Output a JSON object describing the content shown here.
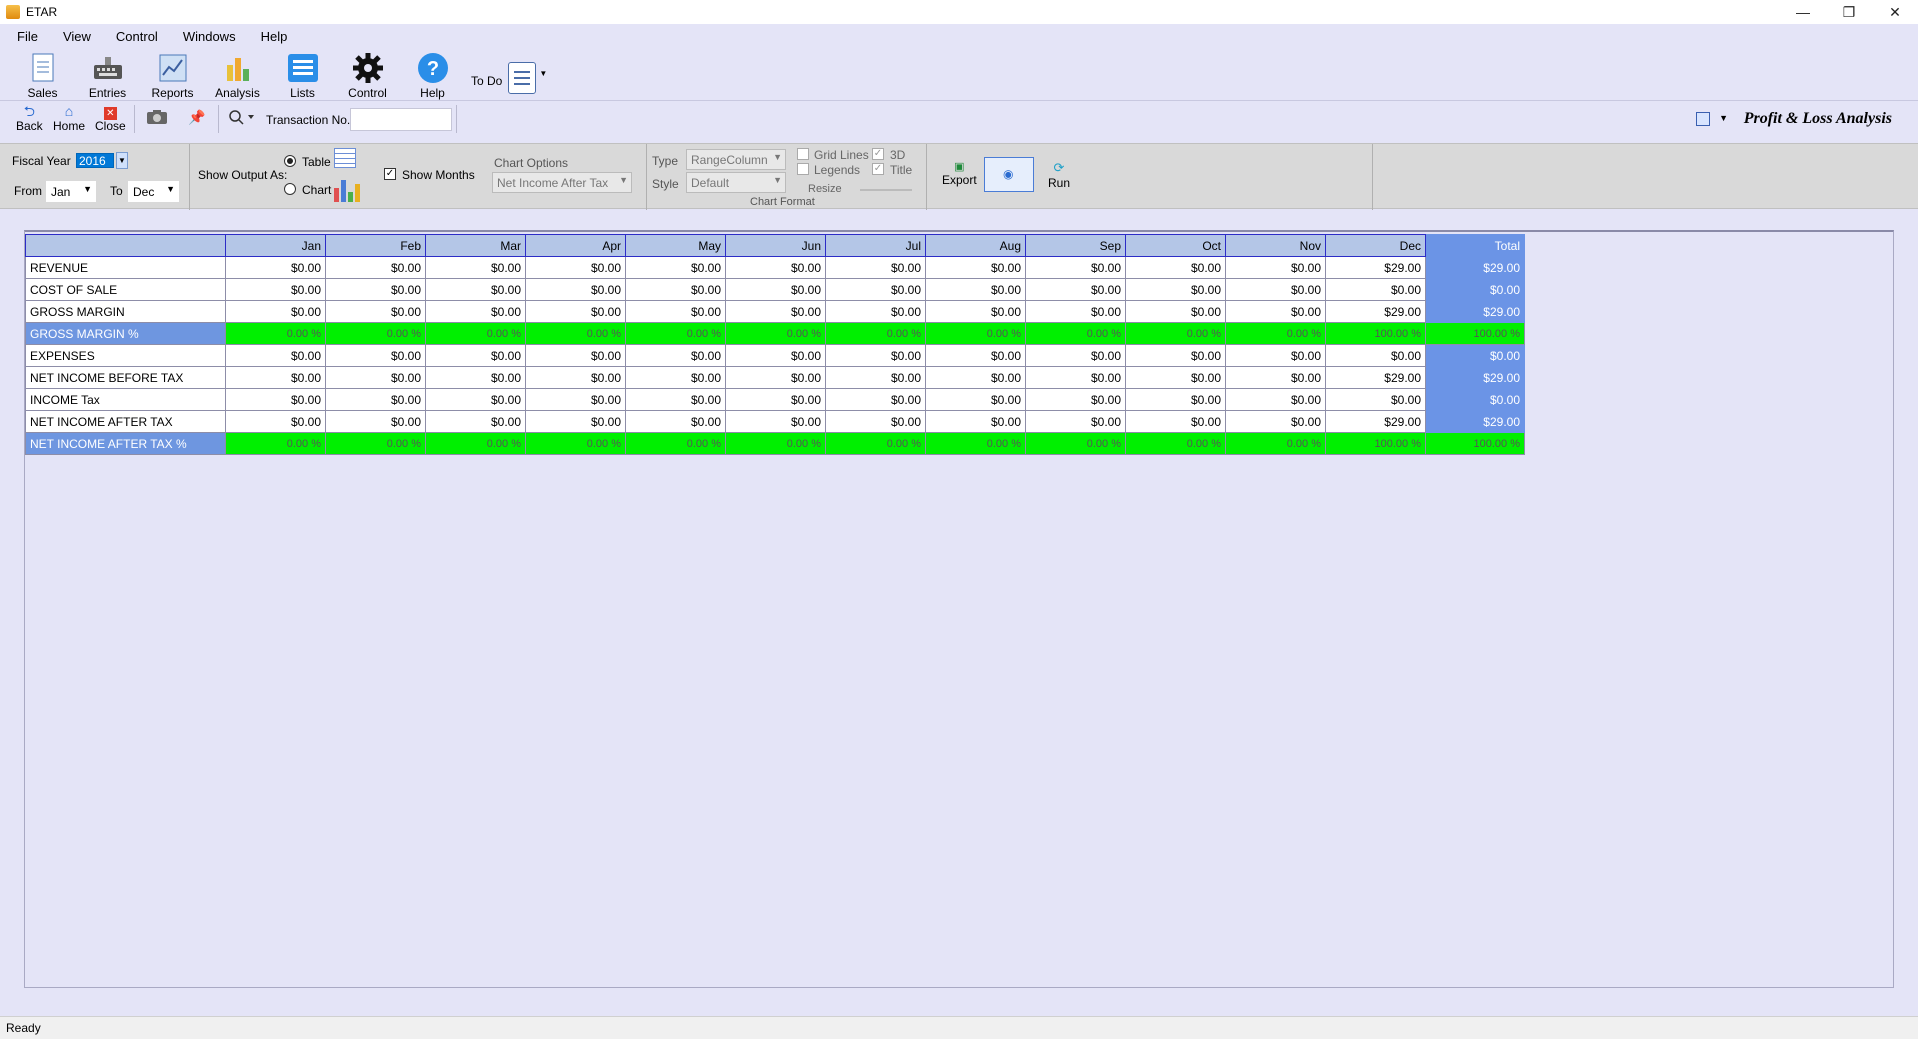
{
  "window": {
    "title": "ETAR",
    "minimize": "—",
    "restore": "❐",
    "close": "✕"
  },
  "menu": [
    "File",
    "View",
    "Control",
    "Windows",
    "Help"
  ],
  "big_toolbar": {
    "items": [
      {
        "label": "Sales",
        "icon": "sales-icon"
      },
      {
        "label": "Entries",
        "icon": "entries-icon"
      },
      {
        "label": "Reports",
        "icon": "reports-icon"
      },
      {
        "label": "Analysis",
        "icon": "analysis-icon"
      },
      {
        "label": "Lists",
        "icon": "lists-icon"
      },
      {
        "label": "Control",
        "icon": "gear-icon"
      },
      {
        "label": "Help",
        "icon": "help-icon"
      }
    ],
    "todo_label": "To Do"
  },
  "small_toolbar": {
    "back": "Back",
    "home": "Home",
    "close": "Close",
    "transaction_label": "Transaction No.",
    "transaction_value": "",
    "page_title": "Profit & Loss Analysis"
  },
  "options": {
    "fiscal_year_label": "Fiscal Year",
    "fiscal_year": "2016",
    "from_label": "From",
    "from_value": "Jan",
    "to_label": "To",
    "to_value": "Dec",
    "show_output_label": "Show Output As:",
    "table_label": "Table",
    "chart_label": "Chart",
    "output_selected": "Table",
    "show_months_label": "Show Months",
    "show_months_checked": true,
    "chart_options_label": "Chart Options",
    "chart_options_value": "Net Income After Tax",
    "type_label": "Type",
    "type_value": "RangeColumn",
    "style_label": "Style",
    "style_value": "Default",
    "chart_format_label": "Chart Format",
    "grid_lines_label": "Grid Lines",
    "legends_label": "Legends",
    "three_d_label": "3D",
    "title_label": "Title",
    "resize_label": "Resize",
    "export_label": "Export",
    "run_label": "Run"
  },
  "table": {
    "columns": [
      "Jan",
      "Feb",
      "Mar",
      "Apr",
      "May",
      "Jun",
      "Jul",
      "Aug",
      "Sep",
      "Oct",
      "Nov",
      "Dec",
      "Total"
    ],
    "rows": [
      {
        "label": "REVENUE",
        "pct": false,
        "values": [
          "$0.00",
          "$0.00",
          "$0.00",
          "$0.00",
          "$0.00",
          "$0.00",
          "$0.00",
          "$0.00",
          "$0.00",
          "$0.00",
          "$0.00",
          "$29.00",
          "$29.00"
        ]
      },
      {
        "label": "COST OF SALE",
        "pct": false,
        "values": [
          "$0.00",
          "$0.00",
          "$0.00",
          "$0.00",
          "$0.00",
          "$0.00",
          "$0.00",
          "$0.00",
          "$0.00",
          "$0.00",
          "$0.00",
          "$0.00",
          "$0.00"
        ]
      },
      {
        "label": "GROSS MARGIN",
        "pct": false,
        "values": [
          "$0.00",
          "$0.00",
          "$0.00",
          "$0.00",
          "$0.00",
          "$0.00",
          "$0.00",
          "$0.00",
          "$0.00",
          "$0.00",
          "$0.00",
          "$29.00",
          "$29.00"
        ]
      },
      {
        "label": "GROSS MARGIN %",
        "pct": true,
        "values": [
          "0.00 %",
          "0.00 %",
          "0.00 %",
          "0.00 %",
          "0.00 %",
          "0.00 %",
          "0.00 %",
          "0.00 %",
          "0.00 %",
          "0.00 %",
          "0.00 %",
          "100.00 %",
          "100.00 %"
        ]
      },
      {
        "label": "EXPENSES",
        "pct": false,
        "values": [
          "$0.00",
          "$0.00",
          "$0.00",
          "$0.00",
          "$0.00",
          "$0.00",
          "$0.00",
          "$0.00",
          "$0.00",
          "$0.00",
          "$0.00",
          "$0.00",
          "$0.00"
        ]
      },
      {
        "label": "NET INCOME BEFORE TAX",
        "pct": false,
        "values": [
          "$0.00",
          "$0.00",
          "$0.00",
          "$0.00",
          "$0.00",
          "$0.00",
          "$0.00",
          "$0.00",
          "$0.00",
          "$0.00",
          "$0.00",
          "$29.00",
          "$29.00"
        ]
      },
      {
        "label": "INCOME Tax",
        "pct": false,
        "values": [
          "$0.00",
          "$0.00",
          "$0.00",
          "$0.00",
          "$0.00",
          "$0.00",
          "$0.00",
          "$0.00",
          "$0.00",
          "$0.00",
          "$0.00",
          "$0.00",
          "$0.00"
        ]
      },
      {
        "label": "NET INCOME AFTER TAX",
        "pct": false,
        "values": [
          "$0.00",
          "$0.00",
          "$0.00",
          "$0.00",
          "$0.00",
          "$0.00",
          "$0.00",
          "$0.00",
          "$0.00",
          "$0.00",
          "$0.00",
          "$29.00",
          "$29.00"
        ]
      },
      {
        "label": "NET INCOME AFTER TAX %",
        "pct": true,
        "values": [
          "0.00 %",
          "0.00 %",
          "0.00 %",
          "0.00 %",
          "0.00 %",
          "0.00 %",
          "0.00 %",
          "0.00 %",
          "0.00 %",
          "0.00 %",
          "0.00 %",
          "100.00 %",
          "100.00 %"
        ]
      }
    ]
  },
  "status": "Ready"
}
